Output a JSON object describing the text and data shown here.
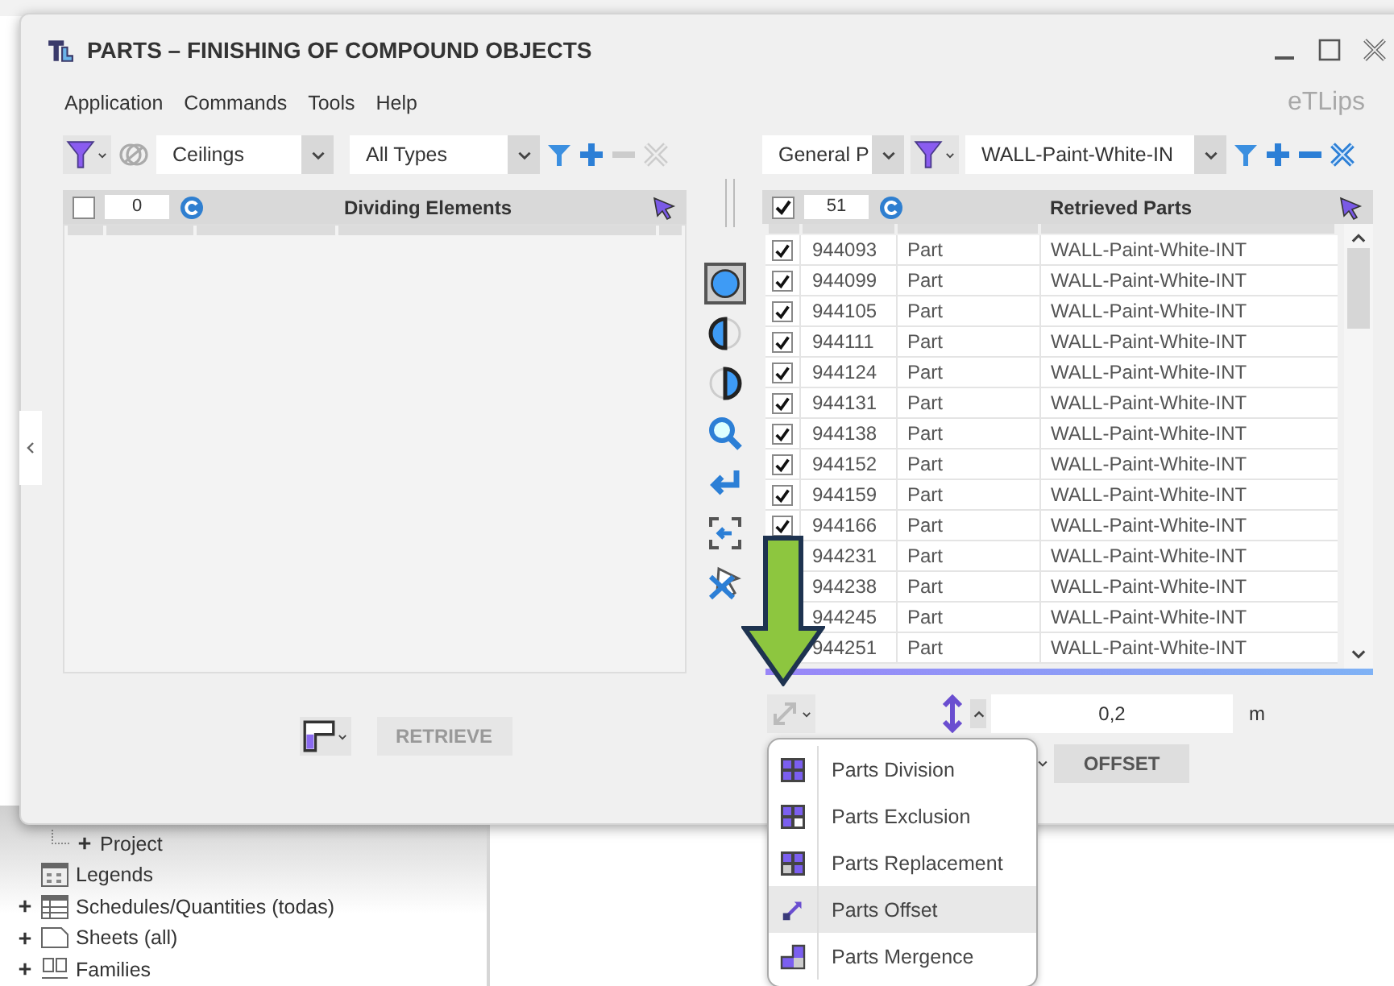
{
  "window": {
    "title": "PARTS – FINISHING OF COMPOUND OBJECTS",
    "brand": "eTLips"
  },
  "menu": [
    "Application",
    "Commands",
    "Tools",
    "Help"
  ],
  "left_panel": {
    "category": "Ceilings",
    "type": "All Types",
    "count": "0",
    "checked": false,
    "title": "Dividing Elements",
    "button": "RETRIEVE"
  },
  "center_tools": [
    {
      "kind": "full",
      "selected": true
    },
    {
      "kind": "left",
      "selected": false
    },
    {
      "kind": "right",
      "selected": false
    },
    {
      "kind": "search",
      "selected": false
    },
    {
      "kind": "enter",
      "selected": false
    },
    {
      "kind": "focus",
      "selected": false
    },
    {
      "kind": "deselect",
      "selected": false
    }
  ],
  "right_panel": {
    "parameter": "General P",
    "value_filter": "WALL-Paint-White-IN",
    "count": "51",
    "checked": true,
    "title": "Retrieved Parts",
    "rows": [
      {
        "checked": true,
        "id": "944093",
        "category": "Part",
        "type": "WALL-Paint-White-INT"
      },
      {
        "checked": true,
        "id": "944099",
        "category": "Part",
        "type": "WALL-Paint-White-INT"
      },
      {
        "checked": true,
        "id": "944105",
        "category": "Part",
        "type": "WALL-Paint-White-INT"
      },
      {
        "checked": true,
        "id": "944111",
        "category": "Part",
        "type": "WALL-Paint-White-INT"
      },
      {
        "checked": true,
        "id": "944124",
        "category": "Part",
        "type": "WALL-Paint-White-INT"
      },
      {
        "checked": true,
        "id": "944131",
        "category": "Part",
        "type": "WALL-Paint-White-INT"
      },
      {
        "checked": true,
        "id": "944138",
        "category": "Part",
        "type": "WALL-Paint-White-INT"
      },
      {
        "checked": true,
        "id": "944152",
        "category": "Part",
        "type": "WALL-Paint-White-INT"
      },
      {
        "checked": true,
        "id": "944159",
        "category": "Part",
        "type": "WALL-Paint-White-INT"
      },
      {
        "checked": true,
        "id": "944166",
        "category": "Part",
        "type": "WALL-Paint-White-INT"
      },
      {
        "id": "944231",
        "category": "Part",
        "type": "WALL-Paint-White-INT"
      },
      {
        "id": "944238",
        "category": "Part",
        "type": "WALL-Paint-White-INT"
      },
      {
        "id": "944245",
        "category": "Part",
        "type": "WALL-Paint-White-INT"
      },
      {
        "id": "944251",
        "category": "Part",
        "type": "WALL-Paint-White-INT"
      }
    ],
    "progress": {
      "level": 1
    },
    "offset_value": "0,2",
    "unit": "m",
    "button": "OFFSET"
  },
  "mode_menu": [
    {
      "label": "Parts Division",
      "kind": "division",
      "selected": false
    },
    {
      "label": "Parts Exclusion",
      "kind": "exclusion",
      "selected": false
    },
    {
      "label": "Parts Replacement",
      "kind": "replacement",
      "selected": false
    },
    {
      "label": "Parts Offset",
      "kind": "offset",
      "selected": true
    },
    {
      "label": "Parts Mergence",
      "kind": "mergence",
      "selected": false
    }
  ],
  "project_browser": [
    {
      "label": "Project",
      "kind": "sub"
    },
    {
      "label": "Legends",
      "kind": "legends"
    },
    {
      "label": "Schedules/Quantities (todas)",
      "kind": "schedules"
    },
    {
      "label": "Sheets (all)",
      "kind": "sheets"
    },
    {
      "label": "Families",
      "kind": "families"
    }
  ]
}
